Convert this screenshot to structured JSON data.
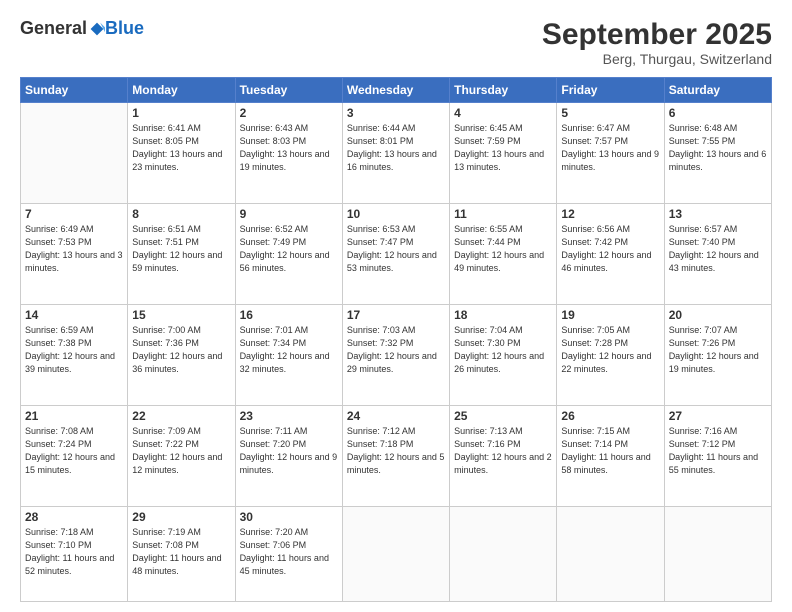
{
  "header": {
    "logo": {
      "general": "General",
      "blue": "Blue"
    },
    "title": "September 2025",
    "location": "Berg, Thurgau, Switzerland"
  },
  "days_of_week": [
    "Sunday",
    "Monday",
    "Tuesday",
    "Wednesday",
    "Thursday",
    "Friday",
    "Saturday"
  ],
  "weeks": [
    [
      {
        "day": "",
        "info": ""
      },
      {
        "day": "1",
        "info": "Sunrise: 6:41 AM\nSunset: 8:05 PM\nDaylight: 13 hours\nand 23 minutes."
      },
      {
        "day": "2",
        "info": "Sunrise: 6:43 AM\nSunset: 8:03 PM\nDaylight: 13 hours\nand 19 minutes."
      },
      {
        "day": "3",
        "info": "Sunrise: 6:44 AM\nSunset: 8:01 PM\nDaylight: 13 hours\nand 16 minutes."
      },
      {
        "day": "4",
        "info": "Sunrise: 6:45 AM\nSunset: 7:59 PM\nDaylight: 13 hours\nand 13 minutes."
      },
      {
        "day": "5",
        "info": "Sunrise: 6:47 AM\nSunset: 7:57 PM\nDaylight: 13 hours\nand 9 minutes."
      },
      {
        "day": "6",
        "info": "Sunrise: 6:48 AM\nSunset: 7:55 PM\nDaylight: 13 hours\nand 6 minutes."
      }
    ],
    [
      {
        "day": "7",
        "info": "Sunrise: 6:49 AM\nSunset: 7:53 PM\nDaylight: 13 hours\nand 3 minutes."
      },
      {
        "day": "8",
        "info": "Sunrise: 6:51 AM\nSunset: 7:51 PM\nDaylight: 12 hours\nand 59 minutes."
      },
      {
        "day": "9",
        "info": "Sunrise: 6:52 AM\nSunset: 7:49 PM\nDaylight: 12 hours\nand 56 minutes."
      },
      {
        "day": "10",
        "info": "Sunrise: 6:53 AM\nSunset: 7:47 PM\nDaylight: 12 hours\nand 53 minutes."
      },
      {
        "day": "11",
        "info": "Sunrise: 6:55 AM\nSunset: 7:44 PM\nDaylight: 12 hours\nand 49 minutes."
      },
      {
        "day": "12",
        "info": "Sunrise: 6:56 AM\nSunset: 7:42 PM\nDaylight: 12 hours\nand 46 minutes."
      },
      {
        "day": "13",
        "info": "Sunrise: 6:57 AM\nSunset: 7:40 PM\nDaylight: 12 hours\nand 43 minutes."
      }
    ],
    [
      {
        "day": "14",
        "info": "Sunrise: 6:59 AM\nSunset: 7:38 PM\nDaylight: 12 hours\nand 39 minutes."
      },
      {
        "day": "15",
        "info": "Sunrise: 7:00 AM\nSunset: 7:36 PM\nDaylight: 12 hours\nand 36 minutes."
      },
      {
        "day": "16",
        "info": "Sunrise: 7:01 AM\nSunset: 7:34 PM\nDaylight: 12 hours\nand 32 minutes."
      },
      {
        "day": "17",
        "info": "Sunrise: 7:03 AM\nSunset: 7:32 PM\nDaylight: 12 hours\nand 29 minutes."
      },
      {
        "day": "18",
        "info": "Sunrise: 7:04 AM\nSunset: 7:30 PM\nDaylight: 12 hours\nand 26 minutes."
      },
      {
        "day": "19",
        "info": "Sunrise: 7:05 AM\nSunset: 7:28 PM\nDaylight: 12 hours\nand 22 minutes."
      },
      {
        "day": "20",
        "info": "Sunrise: 7:07 AM\nSunset: 7:26 PM\nDaylight: 12 hours\nand 19 minutes."
      }
    ],
    [
      {
        "day": "21",
        "info": "Sunrise: 7:08 AM\nSunset: 7:24 PM\nDaylight: 12 hours\nand 15 minutes."
      },
      {
        "day": "22",
        "info": "Sunrise: 7:09 AM\nSunset: 7:22 PM\nDaylight: 12 hours\nand 12 minutes."
      },
      {
        "day": "23",
        "info": "Sunrise: 7:11 AM\nSunset: 7:20 PM\nDaylight: 12 hours\nand 9 minutes."
      },
      {
        "day": "24",
        "info": "Sunrise: 7:12 AM\nSunset: 7:18 PM\nDaylight: 12 hours\nand 5 minutes."
      },
      {
        "day": "25",
        "info": "Sunrise: 7:13 AM\nSunset: 7:16 PM\nDaylight: 12 hours\nand 2 minutes."
      },
      {
        "day": "26",
        "info": "Sunrise: 7:15 AM\nSunset: 7:14 PM\nDaylight: 11 hours\nand 58 minutes."
      },
      {
        "day": "27",
        "info": "Sunrise: 7:16 AM\nSunset: 7:12 PM\nDaylight: 11 hours\nand 55 minutes."
      }
    ],
    [
      {
        "day": "28",
        "info": "Sunrise: 7:18 AM\nSunset: 7:10 PM\nDaylight: 11 hours\nand 52 minutes."
      },
      {
        "day": "29",
        "info": "Sunrise: 7:19 AM\nSunset: 7:08 PM\nDaylight: 11 hours\nand 48 minutes."
      },
      {
        "day": "30",
        "info": "Sunrise: 7:20 AM\nSunset: 7:06 PM\nDaylight: 11 hours\nand 45 minutes."
      },
      {
        "day": "",
        "info": ""
      },
      {
        "day": "",
        "info": ""
      },
      {
        "day": "",
        "info": ""
      },
      {
        "day": "",
        "info": ""
      }
    ]
  ]
}
